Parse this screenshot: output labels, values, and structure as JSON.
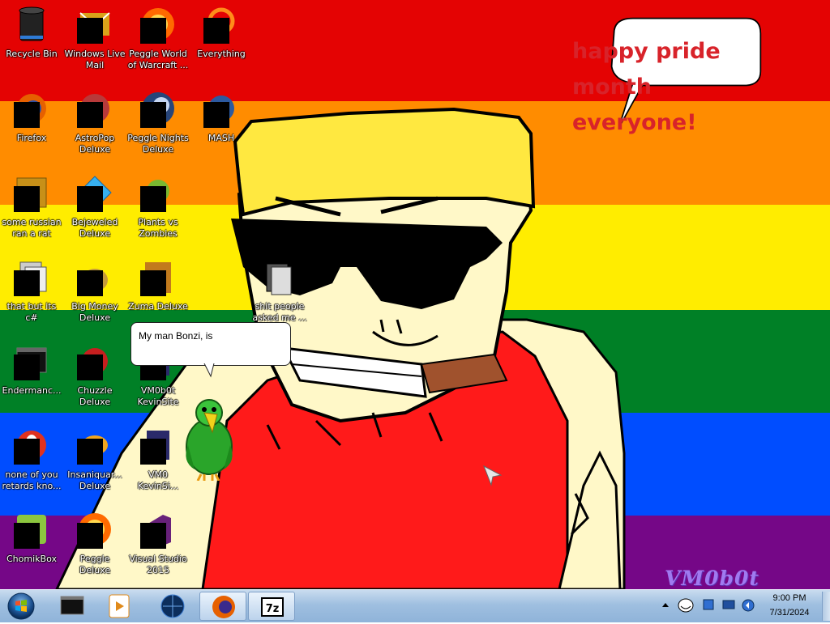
{
  "wallpaper": {
    "stripe_colors": [
      "#e40303",
      "#ff8c00",
      "#ffed00",
      "#008026",
      "#004dff",
      "#750787"
    ],
    "speech_bubble": {
      "lines": [
        "happy pride month",
        "everyone!"
      ],
      "color": "#d8232a"
    },
    "watermark": "VM0b0t"
  },
  "desktop_icons": [
    {
      "id": "recycle-bin",
      "label": [
        "Recycle Bin"
      ],
      "icon": "recycle-bin-icon",
      "masked": false
    },
    {
      "id": "windows-live-mail",
      "label": [
        "Windows Live",
        "Mail"
      ],
      "icon": "mail-icon",
      "masked": true
    },
    {
      "id": "peggle-world-of-warcraft",
      "label": [
        "Peggle World",
        "of Warcraft ..."
      ],
      "icon": "peggle-icon",
      "masked": true
    },
    {
      "id": "everything",
      "label": [
        "Everything"
      ],
      "icon": "search-icon",
      "masked": true
    },
    {
      "id": "firefox",
      "label": [
        "Firefox"
      ],
      "icon": "firefox-icon",
      "masked": true
    },
    {
      "id": "astropop-deluxe",
      "label": [
        "AstroPop",
        "Deluxe"
      ],
      "icon": "astropop-icon",
      "masked": true
    },
    {
      "id": "peggle-nights-deluxe",
      "label": [
        "Peggle Nights",
        "Deluxe"
      ],
      "icon": "peggle-nights-icon",
      "masked": true
    },
    {
      "id": "mash",
      "label": [
        "MASH"
      ],
      "icon": "mash-icon",
      "masked": true
    },
    {
      "id": "some-russian-ran-a-rat",
      "label": [
        "some russian",
        "ran a rat"
      ],
      "icon": "media-file-icon",
      "masked": true
    },
    {
      "id": "bejeweled-deluxe",
      "label": [
        "Bejeweled",
        "Deluxe"
      ],
      "icon": "bejeweled-icon",
      "masked": true
    },
    {
      "id": "plants-vs-zombies",
      "label": [
        "Plants vs",
        "Zombies"
      ],
      "icon": "plants-vs-zombies-icon",
      "masked": true
    },
    {
      "id": "that-but-its-csharp",
      "label": [
        "that but its c#"
      ],
      "icon": "shortcut-icon",
      "masked": true
    },
    {
      "id": "big-money-deluxe",
      "label": [
        "Big Money",
        "Deluxe"
      ],
      "icon": "money-bag-icon",
      "masked": true
    },
    {
      "id": "zuma-deluxe",
      "label": [
        "Zuma Deluxe"
      ],
      "icon": "zuma-icon",
      "masked": true
    },
    {
      "id": "shit-people-asked-me",
      "label": [
        "shit people",
        "asked me ..."
      ],
      "icon": "folder-icon",
      "masked": false
    },
    {
      "id": "endermanch",
      "label": [
        "Endermanc..."
      ],
      "icon": "terminal-icon",
      "masked": true
    },
    {
      "id": "chuzzle-deluxe",
      "label": [
        "Chuzzle",
        "Deluxe"
      ],
      "icon": "chuzzle-icon",
      "masked": true
    },
    {
      "id": "vm0b0t-kevinsite",
      "label": [
        "VM0b0t",
        "KevinSite"
      ],
      "icon": "website-icon",
      "masked": true
    },
    {
      "id": "none-of-you",
      "label": [
        "none of you",
        "retards kno..."
      ],
      "icon": "opera-icon",
      "masked": true
    },
    {
      "id": "insaniquarium-deluxe",
      "label": [
        "Insaniquar...",
        "Deluxe"
      ],
      "icon": "fish-icon",
      "masked": true
    },
    {
      "id": "vm0-kevinsi",
      "label": [
        "VM0",
        "KevinSi..."
      ],
      "icon": "website-icon",
      "masked": true
    },
    {
      "id": "chomikbox",
      "label": [
        "ChomikBox"
      ],
      "icon": "chomikbox-icon",
      "masked": true
    },
    {
      "id": "peggle-deluxe",
      "label": [
        "Peggle Deluxe"
      ],
      "icon": "peggle-icon",
      "masked": true
    },
    {
      "id": "visual-studio-2015",
      "label": [
        "Visual Studio",
        "2015"
      ],
      "icon": "visual-studio-icon",
      "masked": true
    }
  ],
  "bonzi": {
    "bubble_text": "My man Bonzi, is"
  },
  "taskbar": {
    "pinned": [
      {
        "id": "cmd",
        "icon": "terminal-icon",
        "active": false
      },
      {
        "id": "media-player",
        "icon": "media-player-icon",
        "active": false
      },
      {
        "id": "browser-globe",
        "icon": "globe-icon",
        "active": false
      },
      {
        "id": "firefox",
        "icon": "firefox-icon",
        "active": true
      },
      {
        "id": "7zip",
        "icon": "7zip-icon",
        "active": true
      }
    ],
    "tray": {
      "time": "9:00 PM",
      "date": "7/31/2024"
    }
  }
}
